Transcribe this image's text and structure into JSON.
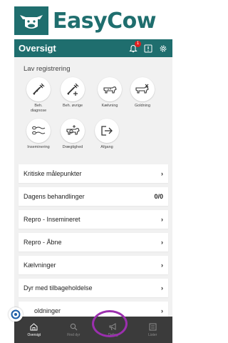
{
  "brand": {
    "name": "EasyCow",
    "color": "#1f6e6e"
  },
  "appbar": {
    "title": "Oversigt",
    "notification_count": "1"
  },
  "registration": {
    "title": "Lav registrering",
    "tiles": [
      {
        "label": "Beh.\ndiagnose",
        "icon": "syringe-icon"
      },
      {
        "label": "Beh. øvrige",
        "icon": "syringe-plus-icon"
      },
      {
        "label": "Kælvning",
        "icon": "cow-icon"
      },
      {
        "label": "Goldning",
        "icon": "cow-x-icon"
      },
      {
        "label": "Inseminering",
        "icon": "sperm-icon"
      },
      {
        "label": "Drægtighed",
        "icon": "pregnant-cow-icon"
      },
      {
        "label": "Afgang",
        "icon": "exit-icon"
      }
    ]
  },
  "list": [
    {
      "label": "Kritiske målepunkter",
      "right": "›"
    },
    {
      "label": "Dagens behandlinger",
      "right": "0/0"
    },
    {
      "label": "Repro - Insemineret",
      "right": "›"
    },
    {
      "label": "Repro - Åbne",
      "right": "›"
    },
    {
      "label": "Kælvninger",
      "right": "›"
    },
    {
      "label": "Dyr med tilbageholdelse",
      "right": "›"
    },
    {
      "label": "oldninger",
      "right": "›"
    }
  ],
  "nav": [
    {
      "label": "Oversigt",
      "icon": "home-icon",
      "active": true
    },
    {
      "label": "Find dyr",
      "icon": "search-icon",
      "active": false
    },
    {
      "label": "Deling",
      "icon": "megaphone-icon",
      "active": false
    },
    {
      "label": "Lister",
      "icon": "list-icon",
      "active": false
    }
  ],
  "highlight_color": "#9b2fae"
}
